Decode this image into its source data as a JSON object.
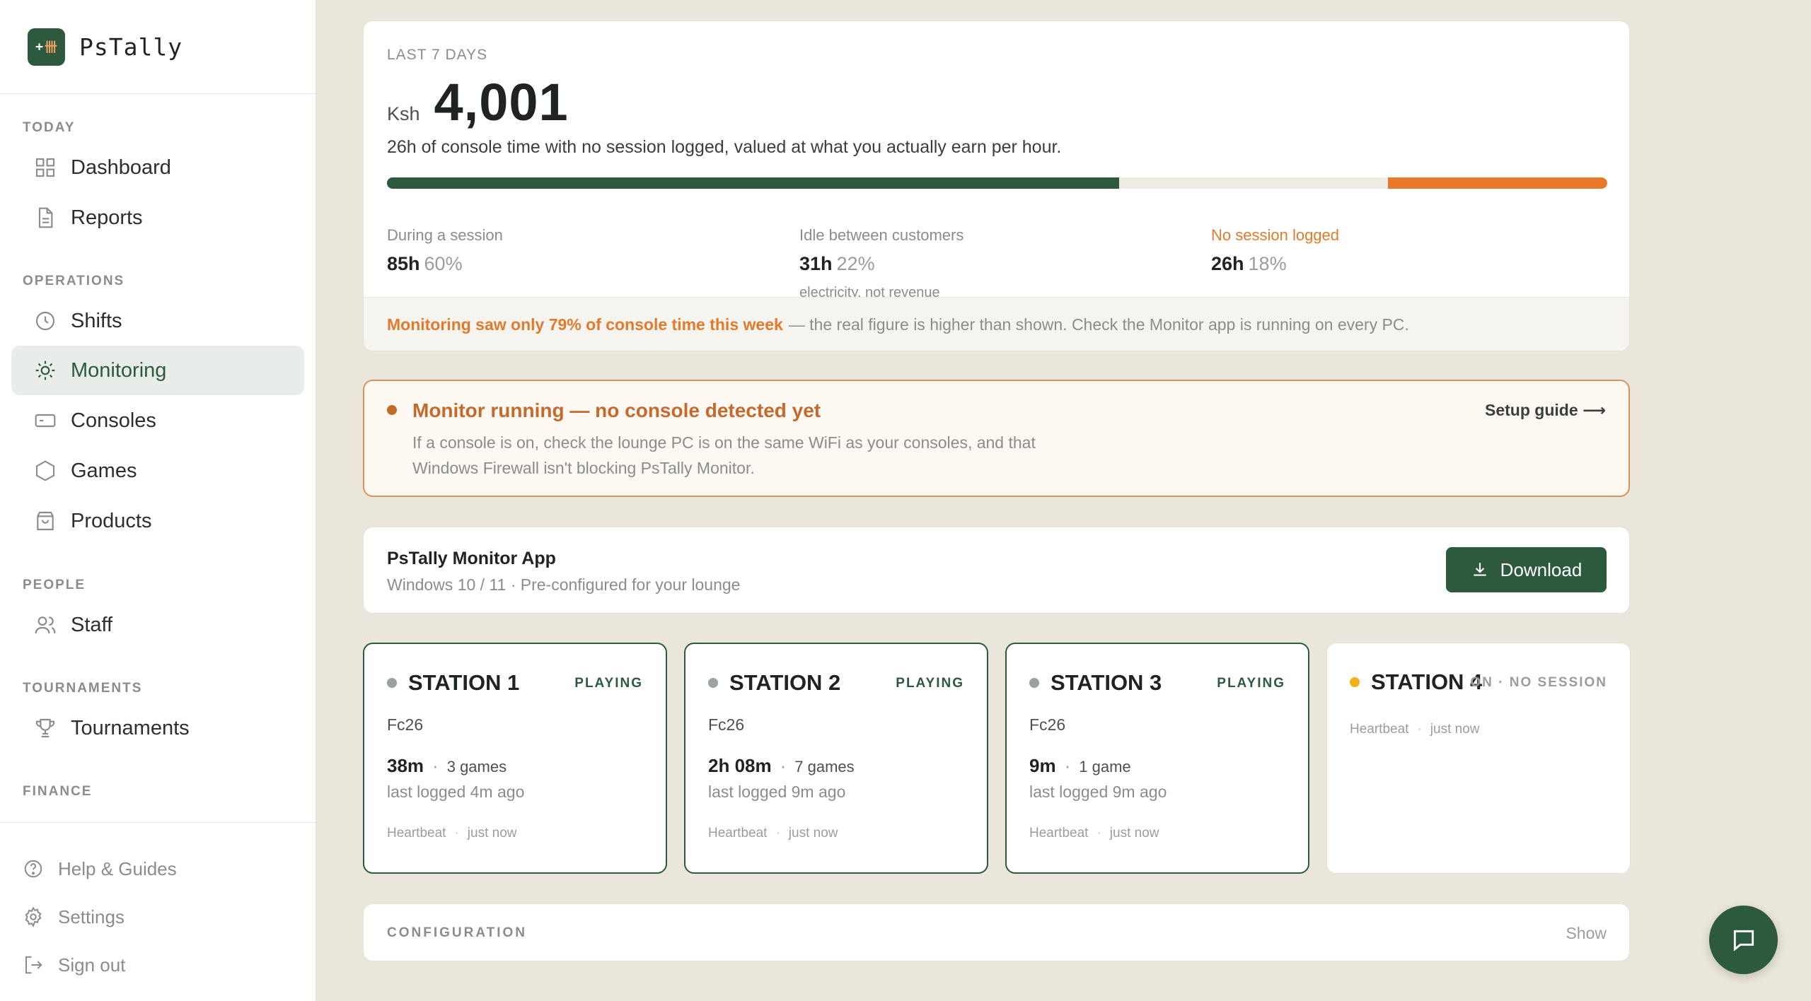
{
  "app": {
    "name": "PsTally",
    "logo_text": "卌"
  },
  "sidebar": {
    "sections": [
      {
        "title": "TODAY"
      },
      {
        "title": "OPERATIONS"
      },
      {
        "title": "PEOPLE"
      },
      {
        "title": "TOURNAMENTS"
      },
      {
        "title": "FINANCE"
      }
    ],
    "items": [
      {
        "label": "Dashboard",
        "icon": "grid-icon"
      },
      {
        "label": "Reports",
        "icon": "document-icon"
      },
      {
        "label": "Shifts",
        "icon": "clock-icon"
      },
      {
        "label": "Monitoring",
        "icon": "sun-icon",
        "active": true
      },
      {
        "label": "Consoles",
        "icon": "console-icon"
      },
      {
        "label": "Games",
        "icon": "hexagon-icon"
      },
      {
        "label": "Products",
        "icon": "bag-icon"
      },
      {
        "label": "Staff",
        "icon": "users-icon"
      },
      {
        "label": "Tournaments",
        "icon": "trophy-icon"
      }
    ],
    "footer": [
      {
        "label": "Help & Guides",
        "icon": "help-icon"
      },
      {
        "label": "Settings",
        "icon": "gear-icon"
      },
      {
        "label": "Sign out",
        "icon": "signout-icon"
      }
    ]
  },
  "summary": {
    "eyebrow": "LAST 7 DAYS",
    "currency": "Ksh",
    "amount": "4,001",
    "description": "26h of console time with no session logged, valued at what you actually earn per hour.",
    "segments": [
      {
        "fraction": 0.6,
        "color": "#2d5a3f"
      },
      {
        "fraction": 0.22,
        "color": "#efece5"
      },
      {
        "fraction": 0.18,
        "color": "#e8782c"
      }
    ],
    "stats": [
      {
        "label": "During a session",
        "hours": "85h",
        "pct": "60%",
        "note": ""
      },
      {
        "label": "Idle between customers",
        "hours": "31h",
        "pct": "22%",
        "note": "electricity, not revenue"
      },
      {
        "label": "No session logged",
        "hours": "26h",
        "pct": "18%",
        "note": ""
      }
    ],
    "footer_highlight": "Monitoring saw only 79% of console time this week",
    "footer_rest": "— the real figure is higher than shown. Check the Monitor app is running on every PC."
  },
  "alert": {
    "title": "Monitor running — no console detected yet",
    "body": "If a console is on, check the lounge PC is on the same WiFi as your consoles, and that Windows Firewall isn't blocking PsTally Monitor.",
    "link": "Setup guide ⟶"
  },
  "monitor_app": {
    "title": "PsTally Monitor App",
    "subtitle": "Windows 10 / 11 · Pre-configured for your lounge",
    "download_label": "Download"
  },
  "stations": [
    {
      "name": "STATION 1",
      "status": "PLAYING",
      "game": "Fc26",
      "time": "38m",
      "games": "3 games",
      "logged": "last logged 4m ago",
      "heartbeat": "Heartbeat",
      "heartbeat_a": "just",
      "heartbeat_b": "now"
    },
    {
      "name": "STATION 2",
      "status": "PLAYING",
      "game": "Fc26",
      "time": "2h 08m",
      "games": "7 games",
      "logged": "last logged 9m ago",
      "heartbeat": "Heartbeat",
      "heartbeat_a": "just",
      "heartbeat_b": "now"
    },
    {
      "name": "STATION 3",
      "status": "PLAYING",
      "game": "Fc26",
      "time": "9m",
      "games": "1 game",
      "logged": "last logged 9m ago",
      "heartbeat": "Heartbeat",
      "heartbeat_a": "just",
      "heartbeat_b": "now"
    },
    {
      "name": "STATION 4",
      "status": "ON · NO SESSION",
      "heartbeat": "Heartbeat",
      "heartbeat_a": "just",
      "heartbeat_b": "now"
    }
  ],
  "configuration": {
    "title": "CONFIGURATION",
    "toggle": "Show"
  },
  "colors": {
    "brand": "#2d5a3f",
    "warning": "#e07b2e",
    "idle_dot": "#f1b11d"
  }
}
